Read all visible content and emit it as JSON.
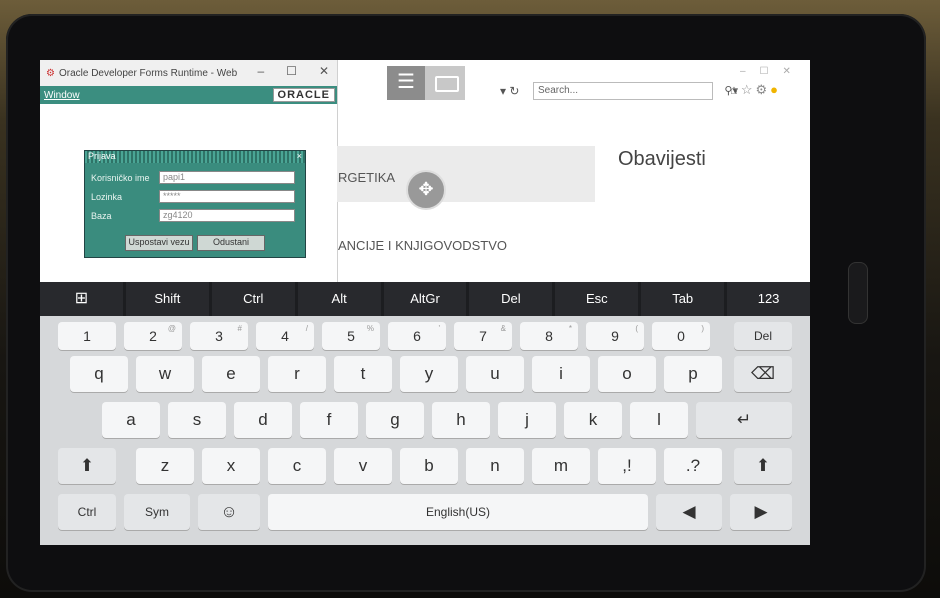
{
  "oracle": {
    "title": "Oracle Developer Forms Runtime - Web",
    "menu": "Window",
    "logo": "ORACLE",
    "dialog": {
      "title": "Prijava",
      "close": "×",
      "user_label": "Korisničko ime",
      "user_value": "papi1",
      "pass_label": "Lozinka",
      "pass_value": "*****",
      "db_label": "Baza",
      "db_value": "zg4120",
      "connect_button": "Uspostavi vezu",
      "cancel_button": "Odustani"
    }
  },
  "browser": {
    "search_placeholder": "Search...",
    "page_heading": "Obavijesti",
    "text1": "RGETIKA",
    "text2": "ANCIJE I KNJIGOVODSTVO"
  },
  "fn_keys": [
    "⊞",
    "Shift",
    "Ctrl",
    "Alt",
    "AltGr",
    "Del",
    "Esc",
    "Tab",
    "123"
  ],
  "keys": {
    "row1": [
      "1",
      "2",
      "3",
      "4",
      "5",
      "6",
      "7",
      "8",
      "9",
      "0"
    ],
    "row1_sup": [
      "",
      "@",
      "#",
      "/",
      "%",
      "'",
      "&",
      "*",
      "(",
      ")"
    ],
    "row1_del": "Del",
    "row2": [
      "q",
      "w",
      "e",
      "r",
      "t",
      "y",
      "u",
      "i",
      "o",
      "p"
    ],
    "row3": [
      "a",
      "s",
      "d",
      "f",
      "g",
      "h",
      "j",
      "k",
      "l"
    ],
    "row4": [
      "z",
      "x",
      "c",
      "v",
      "b",
      "n",
      "m",
      ",!",
      ".?"
    ],
    "ctrl": "Ctrl",
    "sym": "Sym",
    "space": "English(US)"
  }
}
